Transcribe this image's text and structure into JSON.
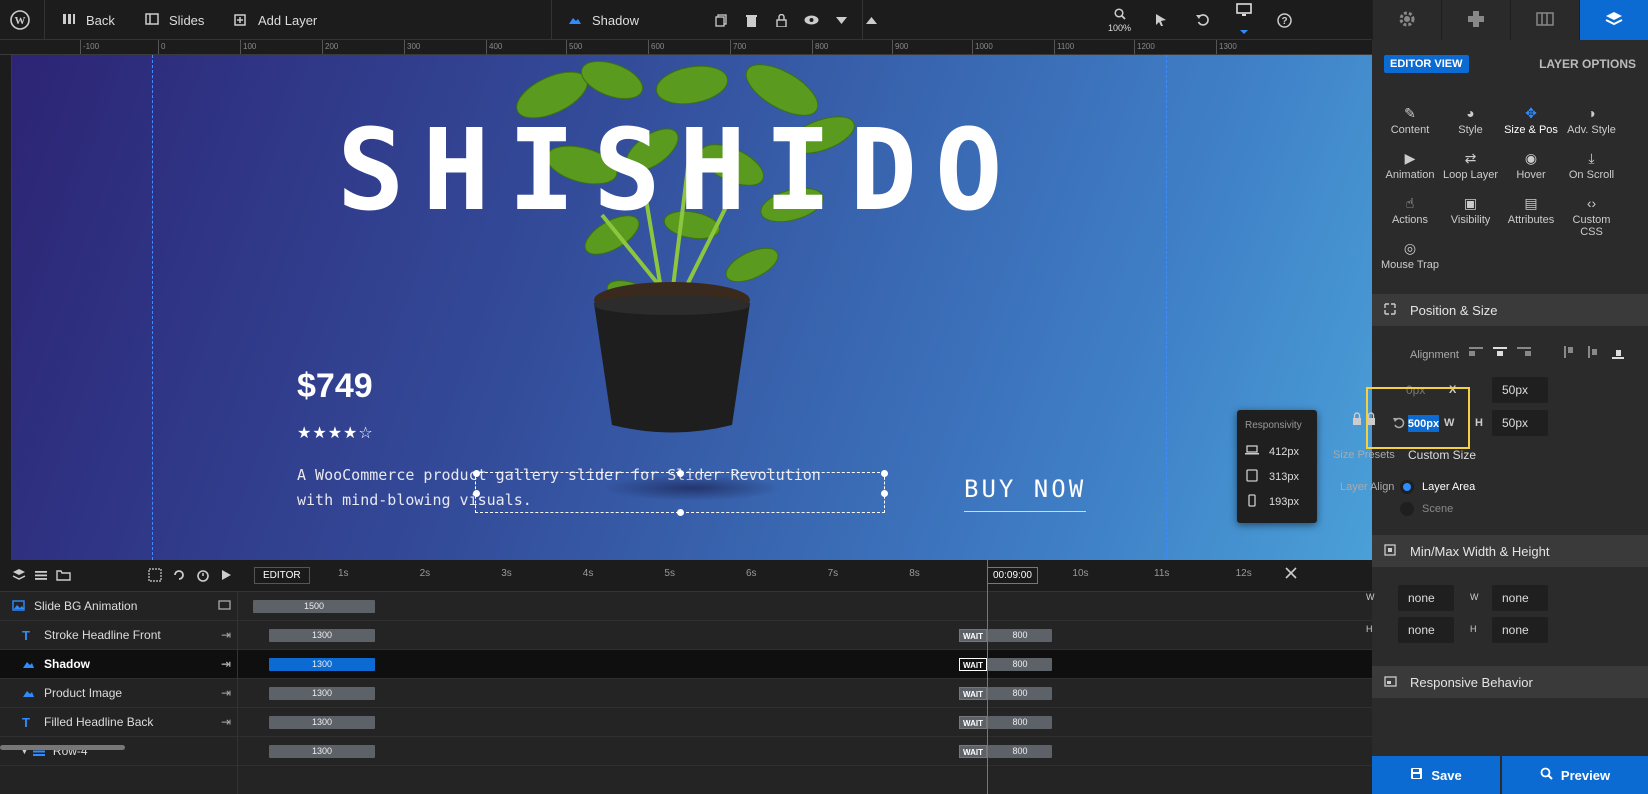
{
  "toolbar": {
    "back": "Back",
    "slides": "Slides",
    "add_layer": "Add Layer",
    "layer_name": "Shadow",
    "zoom": "100%"
  },
  "ruler": {
    "ticks": [
      "-100",
      "0",
      "100",
      "200",
      "300",
      "400",
      "500",
      "600",
      "700",
      "800",
      "900",
      "1000",
      "1100",
      "1200",
      "1300"
    ]
  },
  "slide": {
    "title": "SHISHIDO",
    "price": "$749",
    "stars": "★★★★☆",
    "description": "A WooCommerce product gallery slider for Slider Revolution with mind-blowing visuals.",
    "buy": "BUY NOW"
  },
  "responsivity": {
    "header": "Responsivity",
    "items": [
      {
        "label": "412px",
        "icon": "laptop-icon"
      },
      {
        "label": "313px",
        "icon": "tablet-icon"
      },
      {
        "label": "193px",
        "icon": "phone-icon"
      }
    ]
  },
  "timeline": {
    "editor_label": "EDITOR",
    "time": "00:09:00",
    "seconds": [
      "1s",
      "2s",
      "3s",
      "4s",
      "5s",
      "6s",
      "7s",
      "8s",
      "9s",
      "10s",
      "11s",
      "12s"
    ],
    "layers": [
      {
        "name": "Slide BG Animation",
        "bar": "1500"
      },
      {
        "name": "Stroke Headline Front",
        "bar": "1300",
        "wait": "WAIT",
        "end": "800"
      },
      {
        "name": "Shadow",
        "bar": "1300",
        "wait": "WAIT",
        "end": "800"
      },
      {
        "name": "Product Image",
        "bar": "1300",
        "wait": "WAIT",
        "end": "800"
      },
      {
        "name": "Filled Headline Back",
        "bar": "1300",
        "wait": "WAIT",
        "end": "800"
      },
      {
        "name": "Row-4",
        "bar": "1300",
        "wait": "WAIT",
        "end": "800"
      }
    ]
  },
  "panel": {
    "editor_view": "EDITOR VIEW",
    "layer_options": "LAYER OPTIONS",
    "tabs": [
      "Content",
      "Style",
      "Size & Pos",
      "Adv. Style",
      "Animation",
      "Loop Layer",
      "Hover",
      "On Scroll",
      "Actions",
      "Visibility",
      "Attributes",
      "Custom CSS",
      "Mouse Trap"
    ],
    "position_size": "Position & Size",
    "alignment": "Alignment",
    "x_label": "X",
    "x_value": "0px",
    "y_label": "Y",
    "y_value": "50px",
    "w_label": "W",
    "w_value": "500px",
    "h_label": "H",
    "h_value": "50px",
    "size_presets": "Size Presets",
    "size_presets_value": "Custom Size",
    "layer_align": "Layer Align",
    "layer_area": "Layer Area",
    "scene": "Scene",
    "minmax": "Min/Max Width & Height",
    "min_w": "none",
    "max_w": "none",
    "min_h": "none",
    "max_h": "none",
    "responsive": "Responsive Behavior",
    "save": "Save",
    "preview": "Preview"
  },
  "colors": {
    "accent": "#0b6bd3",
    "highlight": "#f5d142"
  }
}
